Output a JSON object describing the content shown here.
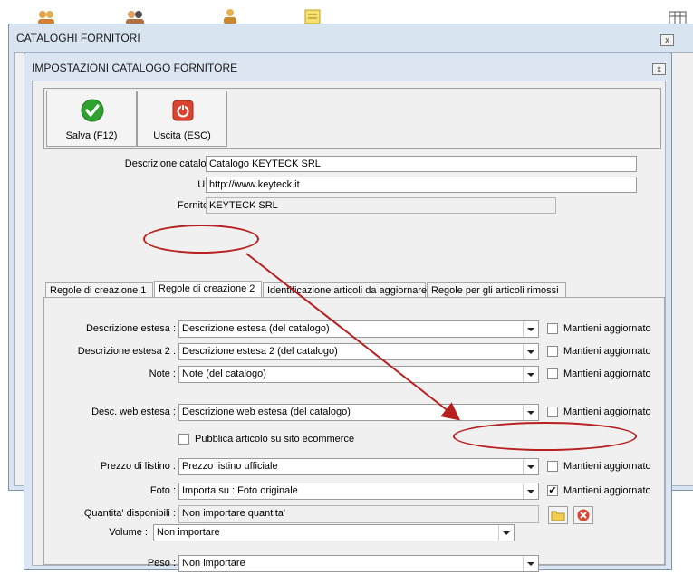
{
  "outer_window": {
    "title": "CATALOGHI FORNITORI",
    "close": "x"
  },
  "dialog": {
    "title": "IMPOSTAZIONI CATALOGO FORNITORE",
    "close": "x"
  },
  "toolbar": {
    "save_label": "Salva (F12)",
    "exit_label": "Uscita (ESC)"
  },
  "form": {
    "descrizione_label": "Descrizione catalogo :",
    "descrizione_value": "Catalogo KEYTECK SRL",
    "url_label": "URL :",
    "url_value": "http://www.keyteck.it",
    "fornitore_label": "Fornitore :",
    "fornitore_value": "KEYTECK SRL"
  },
  "tabs": [
    {
      "label": "Regole di creazione 1"
    },
    {
      "label": "Regole di creazione 2"
    },
    {
      "label": "Identificazione articoli da aggiornare"
    },
    {
      "label": "Regole per gli articoli rimossi"
    }
  ],
  "rows": {
    "desc_estesa": {
      "label": "Descrizione estesa :",
      "value": "Descrizione estesa (del catalogo)",
      "check": "Mantieni aggiornato",
      "checked": false
    },
    "desc_estesa2": {
      "label": "Descrizione estesa 2 :",
      "value": "Descrizione estesa 2 (del catalogo)",
      "check": "Mantieni aggiornato",
      "checked": false
    },
    "note": {
      "label": "Note :",
      "value": "Note (del catalogo)",
      "check": "Mantieni aggiornato",
      "checked": false
    },
    "desc_web": {
      "label": "Desc. web estesa :",
      "value": "Descrizione web estesa (del catalogo)",
      "check": "Mantieni aggiornato",
      "checked": false
    },
    "pubblica": {
      "check": "Pubblica articolo su sito ecommerce",
      "checked": false
    },
    "prezzo": {
      "label": "Prezzo di listino :",
      "value": "Prezzo listino ufficiale",
      "check": "Mantieni aggiornato",
      "checked": false
    },
    "foto": {
      "label": "Foto :",
      "value": "Importa su : Foto originale",
      "check": "Mantieni aggiornato",
      "checked": true,
      "checkmark": "✔"
    },
    "quantita": {
      "label": "Quantita' disponibili :",
      "value": "Non importare quantita'"
    },
    "peso": {
      "label": "Peso :",
      "value": "Non importare"
    },
    "volume": {
      "label": "Volume :",
      "value": "Non importare"
    }
  },
  "colors": {
    "annotation": "#b82020",
    "save_green": "#2fa12f",
    "exit_red": "#d9432f"
  }
}
